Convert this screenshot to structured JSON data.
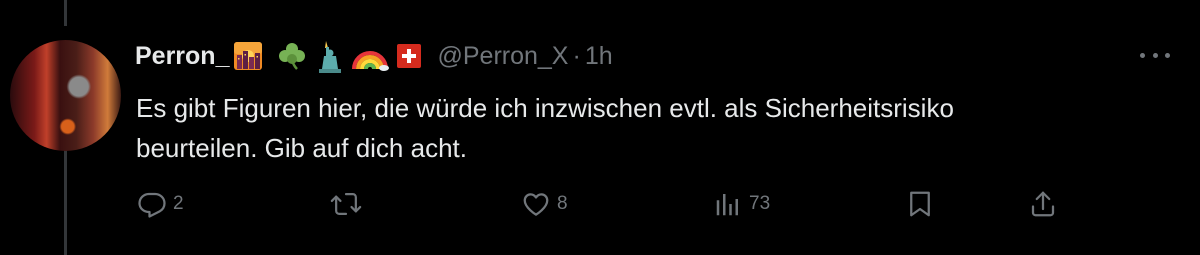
{
  "tweet": {
    "display_name": "Perron_",
    "name_emojis": [
      "sunset-cityscape-emoji",
      "shamrock-emoji",
      "statue-of-liberty-emoji",
      "rainbow-emoji",
      "swiss-flag-emoji"
    ],
    "handle": "@Perron_X",
    "separator": "·",
    "time": "1h",
    "text": "Es gibt Figuren hier, die würde ich inzwischen evtl. als Sicherheitsrisiko\nbeurteilen. Gib auf dich acht."
  },
  "actions": {
    "replies": "2",
    "retweets": "",
    "likes": "8",
    "views": "73"
  },
  "icons": [
    "more-icon",
    "reply-icon",
    "retweet-icon",
    "like-icon",
    "views-icon",
    "bookmark-icon",
    "share-icon"
  ],
  "colors": {
    "background": "#000000",
    "text_primary": "#e7e9ea",
    "text_secondary": "#71767b",
    "thread_line": "#333639"
  }
}
